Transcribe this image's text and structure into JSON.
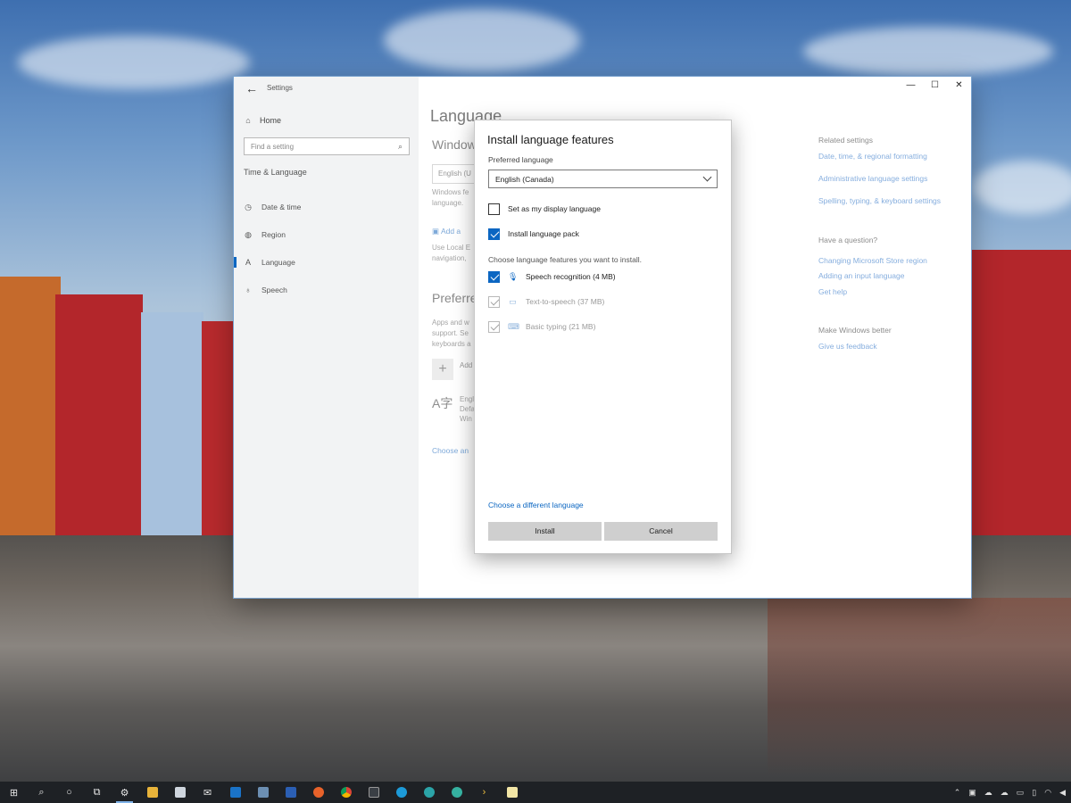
{
  "settings_window": {
    "title": "Settings",
    "controls": {
      "minimize": "—",
      "maximize": "☐",
      "close": "✕"
    },
    "nav": {
      "home_label": "Home",
      "search_placeholder": "Find a setting",
      "section_label": "Time & Language",
      "items": [
        {
          "label": "Date & time",
          "icon": "calendar-clock-icon"
        },
        {
          "label": "Region",
          "icon": "globe-icon"
        },
        {
          "label": "Language",
          "icon": "language-icon",
          "active": true
        },
        {
          "label": "Speech",
          "icon": "microphone-icon"
        }
      ]
    },
    "content": {
      "page_title": "Language",
      "display_heading": "Window",
      "display_select": "English (U",
      "display_text_line1": "Windows fe",
      "display_text_line2": "language.",
      "add_link": "Add a",
      "local_text_line1": "Use Local E",
      "local_text_line2": "navigation,",
      "preferred_heading": "Preferre",
      "pref_text_line1": "Apps and w",
      "pref_text_line2": "support. Se",
      "pref_text_line3": "keyboards a",
      "add_lang_label": "Add",
      "lang_item_line1": "Engl",
      "lang_item_line2": "Defa",
      "lang_item_line3": "Win",
      "choose_link": "Choose an"
    },
    "related": {
      "related_title": "Related settings",
      "related_links": [
        "Date, time, & regional formatting",
        "Administrative language settings",
        "Spelling, typing, & keyboard settings"
      ],
      "question_title": "Have a question?",
      "question_links": [
        "Changing Microsoft Store region",
        "Adding an input language",
        "Get help"
      ],
      "better_title": "Make Windows better",
      "better_link": "Give us feedback"
    }
  },
  "dialog": {
    "title": "Install language features",
    "preferred_label": "Preferred language",
    "preferred_value": "English (Canada)",
    "display_language_label": "Set as my display language",
    "display_language_checked": false,
    "language_pack_label": "Install language pack",
    "language_pack_checked": true,
    "choose_features_label": "Choose language features you want to install.",
    "features": [
      {
        "label": "Speech recognition (4 MB)",
        "icon": "microphone-icon",
        "checked": true,
        "enabled": true
      },
      {
        "label": "Text-to-speech (37 MB)",
        "icon": "speech-bubble-icon",
        "checked": true,
        "enabled": false
      },
      {
        "label": "Basic typing (21 MB)",
        "icon": "keyboard-icon",
        "checked": true,
        "enabled": false
      }
    ],
    "different_language_link": "Choose a different language",
    "install_button": "Install",
    "cancel_button": "Cancel"
  },
  "taskbar": {
    "items": [
      "windows-start-icon",
      "search-icon",
      "cortana-icon",
      "task-view-icon",
      "settings-gear-icon",
      "file-explorer-icon",
      "store-icon",
      "mail-icon",
      "outlook-icon",
      "photos-icon",
      "word-icon",
      "firefox-icon",
      "chrome-icon",
      "terminal-icon",
      "edge-icon",
      "edge-beta-icon",
      "edge-dev-icon",
      "powershell-icon",
      "notes-icon"
    ],
    "tray_icons": [
      "chevron-up-icon",
      "network-icon",
      "onedrive-icon",
      "onedrive-icon",
      "display-icon",
      "battery-icon",
      "wifi-icon",
      "volume-icon"
    ]
  }
}
